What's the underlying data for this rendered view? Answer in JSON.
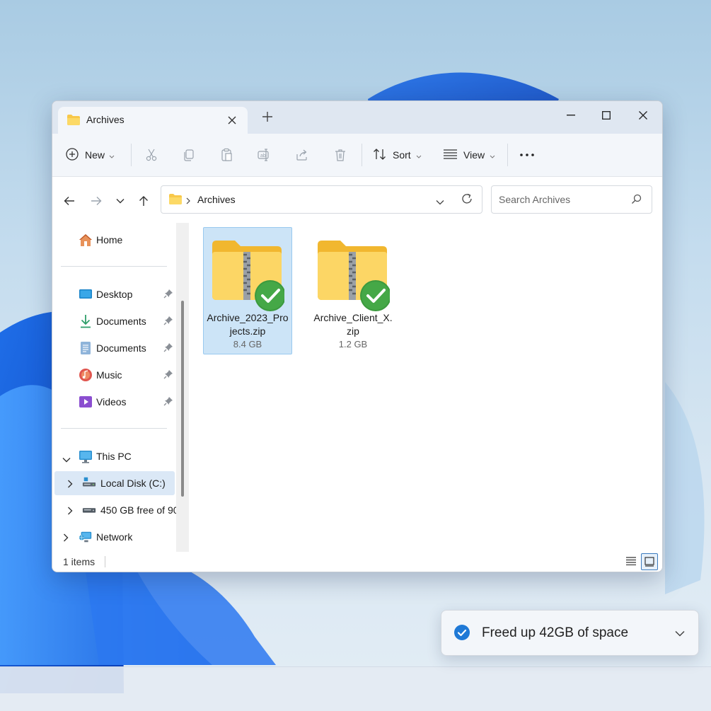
{
  "window": {
    "tab_title": "Archives",
    "icons": {
      "tab": "folder-icon",
      "close_tab": "close-icon",
      "new_tab": "plus-icon"
    }
  },
  "toolbar": {
    "new_label": "New",
    "sort_label": "Sort",
    "view_label": "View",
    "icons": [
      "cut-icon",
      "copy-icon",
      "paste-icon",
      "rename-icon",
      "share-icon",
      "delete-icon",
      "more-icon"
    ]
  },
  "address": {
    "path": "Archives",
    "search_placeholder": "Search Archives"
  },
  "sidebar": {
    "home": "Home",
    "quick_access": [
      {
        "label": "Desktop",
        "icon": "desktop-icon"
      },
      {
        "label": "Documents",
        "icon": "download-icon"
      },
      {
        "label": "Documents",
        "icon": "documents-icon"
      },
      {
        "label": "Music",
        "icon": "music-icon"
      },
      {
        "label": "Videos",
        "icon": "videos-icon"
      }
    ],
    "this_pc": "This PC",
    "local_disk": "Local Disk (C:)",
    "drive": "450 GB free of 90",
    "network": "Network"
  },
  "files": [
    {
      "name": "Archive_2023_Projects.zip",
      "size": "8.4 GB",
      "selected": true,
      "status": "synced"
    },
    {
      "name": "Archive_Client_X.zip",
      "size": "1.2 GB",
      "selected": false,
      "status": "synced"
    }
  ],
  "status": {
    "items_text": "1 items"
  },
  "toast": {
    "message": "Freed up 42GB of space"
  },
  "colors": {
    "accent": "#0078d4",
    "folder": "#f8c84a",
    "check": "#3c9a3e",
    "selection": "#cce4f7"
  }
}
